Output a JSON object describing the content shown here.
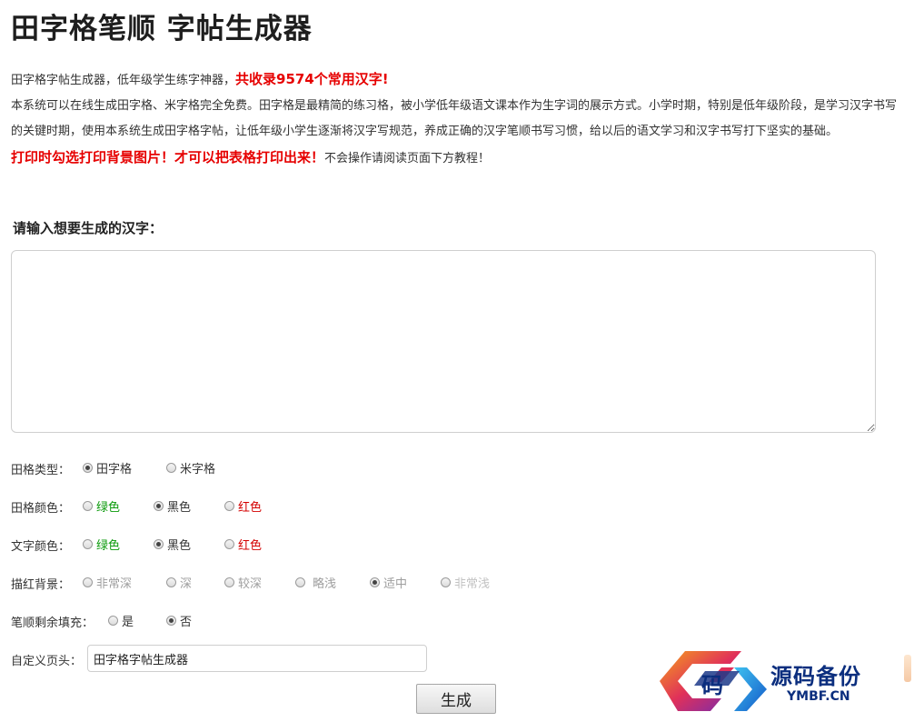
{
  "title": "田字格笔顺 字帖生成器",
  "intro": {
    "line1_prefix": "田字格字帖生成器，低年级学生练字神器，",
    "line1_highlight": "共收录9574个常用汉字!",
    "paragraph": "本系统可以在线生成田字格、米字格完全免费。田字格是最精简的练习格，被小学低年级语文课本作为生字词的展示方式。小学时期，特别是低年级阶段，是学习汉字书写的关键时期，使用本系统生成田字格字帖，让低年级小学生逐渐将汉字写规范，养成正确的汉字笔顺书写习惯，给以后的语文学习和汉字书写打下坚实的基础。",
    "print_warning": "打印时勾选打印背景图片！才可以把表格打印出来！",
    "print_note": "不会操作请阅读页面下方教程！"
  },
  "input": {
    "label": "请输入想要生成的汉字：",
    "value": "",
    "placeholder": ""
  },
  "options": {
    "grid_type": {
      "label": "田格类型：",
      "items": [
        {
          "label": "田字格",
          "checked": true
        },
        {
          "label": "米字格",
          "checked": false
        }
      ]
    },
    "grid_color": {
      "label": "田格颜色：",
      "items": [
        {
          "label": "绿色",
          "checked": false
        },
        {
          "label": "黑色",
          "checked": true
        },
        {
          "label": "红色",
          "checked": false
        }
      ]
    },
    "text_color": {
      "label": "文字颜色：",
      "items": [
        {
          "label": "绿色",
          "checked": false
        },
        {
          "label": "黑色",
          "checked": true
        },
        {
          "label": "红色",
          "checked": false
        }
      ]
    },
    "trace_bg": {
      "label": "描红背景：",
      "items": [
        {
          "label": "非常深",
          "checked": false
        },
        {
          "label": "深",
          "checked": false
        },
        {
          "label": "较深",
          "checked": false
        },
        {
          "label": "略浅",
          "checked": false
        },
        {
          "label": "适中",
          "checked": true
        },
        {
          "label": "非常浅",
          "checked": false
        }
      ]
    },
    "stroke_fill": {
      "label": "笔顺剩余填充：",
      "items": [
        {
          "label": "是",
          "checked": false
        },
        {
          "label": "否",
          "checked": true
        }
      ]
    }
  },
  "custom_header": {
    "label": "自定义页头：",
    "value": "田字格字帖生成器"
  },
  "generate_button": "生成",
  "watermark": {
    "logo_char": "码",
    "name_cn": "源码备份",
    "name_en": "YMBF.CN"
  },
  "colors": {
    "red_highlight": "#e60000",
    "green": "#0a9a0a",
    "red": "#d40000",
    "watermark_blue": "#0b2e7e"
  }
}
